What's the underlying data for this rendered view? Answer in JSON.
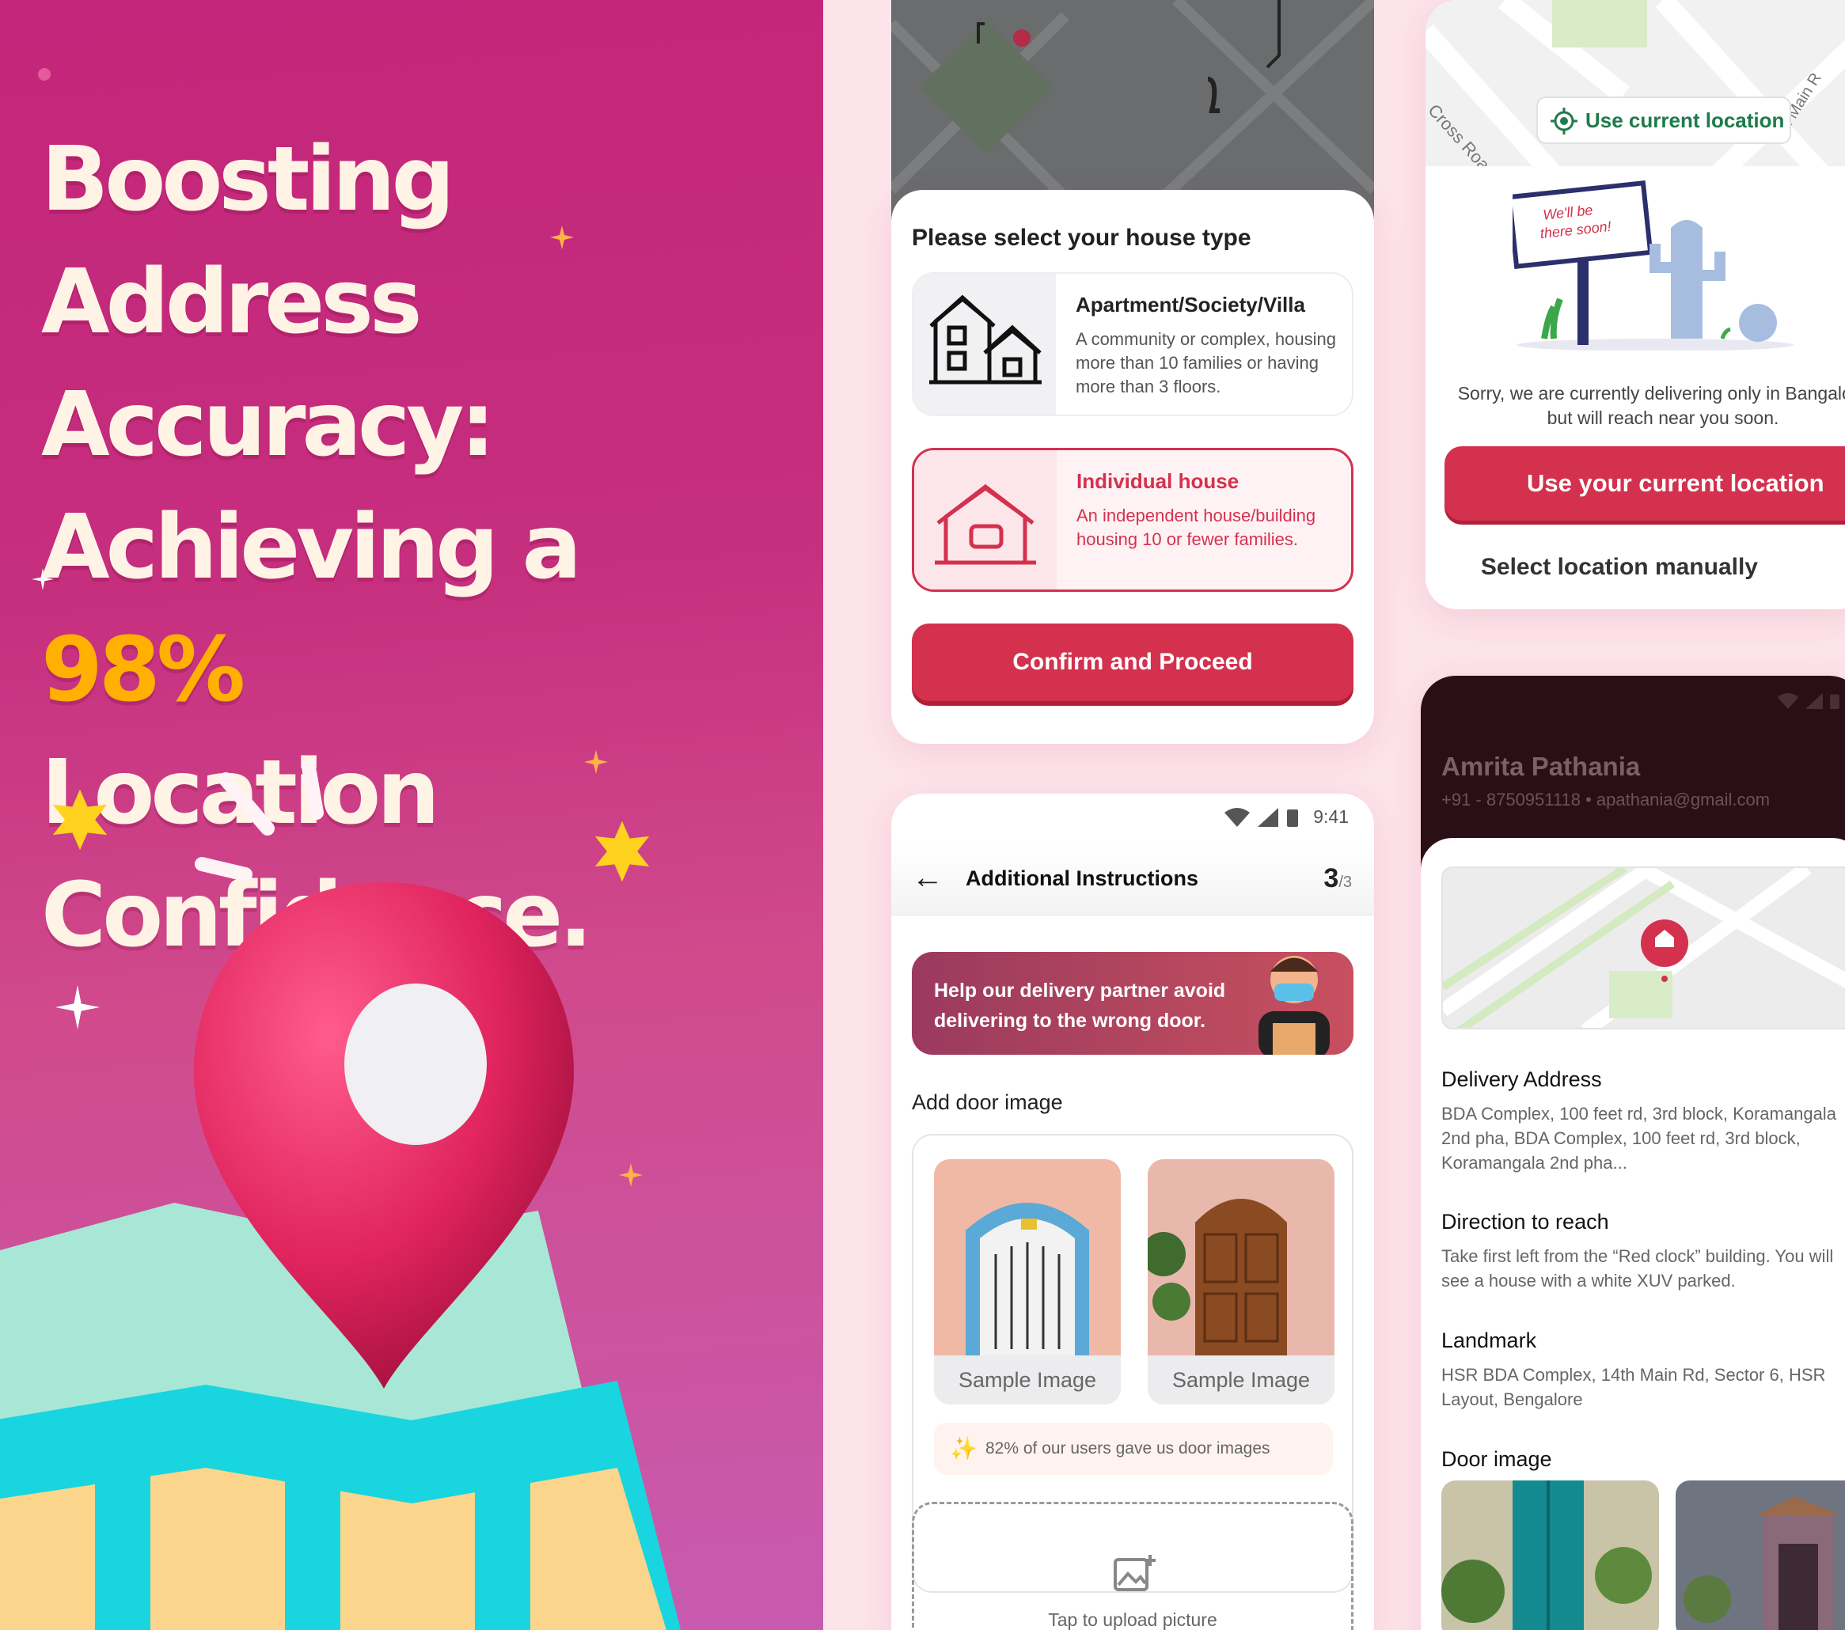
{
  "hero": {
    "title_line1": "Boosting Address",
    "title_line2": "Accuracy:",
    "title_line3_prefix": "Achieving a",
    "title_highlight": "98%",
    "title_line4": "Location",
    "title_line5": "Confidence."
  },
  "colors": {
    "brand_red": "#d4314e",
    "highlight": "#ffb000",
    "green": "#1f7a4c"
  },
  "house_type": {
    "title": "Please select your house type",
    "options": [
      {
        "title": "Apartment/Society/Villa",
        "description": "A community or complex, housing more than 10 families or having more than 3 floors.",
        "icon": "apartment-icon",
        "selected": false
      },
      {
        "title": "Individual house",
        "description": "An independent house/building housing 10 or fewer families.",
        "icon": "house-icon",
        "selected": true
      }
    ],
    "confirm_label": "Confirm and Proceed"
  },
  "instructions": {
    "status_time": "9:41",
    "title": "Additional Instructions",
    "step_current": "3",
    "step_total": "/3",
    "banner_text": "Help our delivery partner avoid delivering to the wrong door.",
    "add_door_label": "Add door image",
    "samples": [
      "Sample Image",
      "Sample Image"
    ],
    "stat_text": "82% of our users gave us door images",
    "upload_text": "Tap to upload picture"
  },
  "location": {
    "use_current_chip": "Use current location",
    "map_road_1": "Cross Road",
    "map_road_2": "th Main R",
    "sign_text": "We'll be there soon!",
    "sorry_text": "Sorry, we are currently delivering only in Bangalore but will reach near you soon.",
    "use_current_button": "Use your current location",
    "manual_link": "Select location manually"
  },
  "profile": {
    "name": "Amrita Pathania",
    "contact": "+91 - 8750951118 • apathania@gmail.com",
    "delivery_label": "Delivery Address",
    "delivery_value": "BDA Complex, 100 feet rd, 3rd block, Koramangala 2nd pha, BDA Complex, 100 feet rd, 3rd block, Koramangala 2nd pha...",
    "direction_label": "Direction to reach",
    "direction_value": "Take first left from the “Red clock” building. You will see a house with a white XUV parked.",
    "landmark_label": "Landmark",
    "landmark_value": "HSR BDA Complex, 14th Main Rd, Sector 6, HSR Layout, Bengalore",
    "door_label": "Door image"
  }
}
